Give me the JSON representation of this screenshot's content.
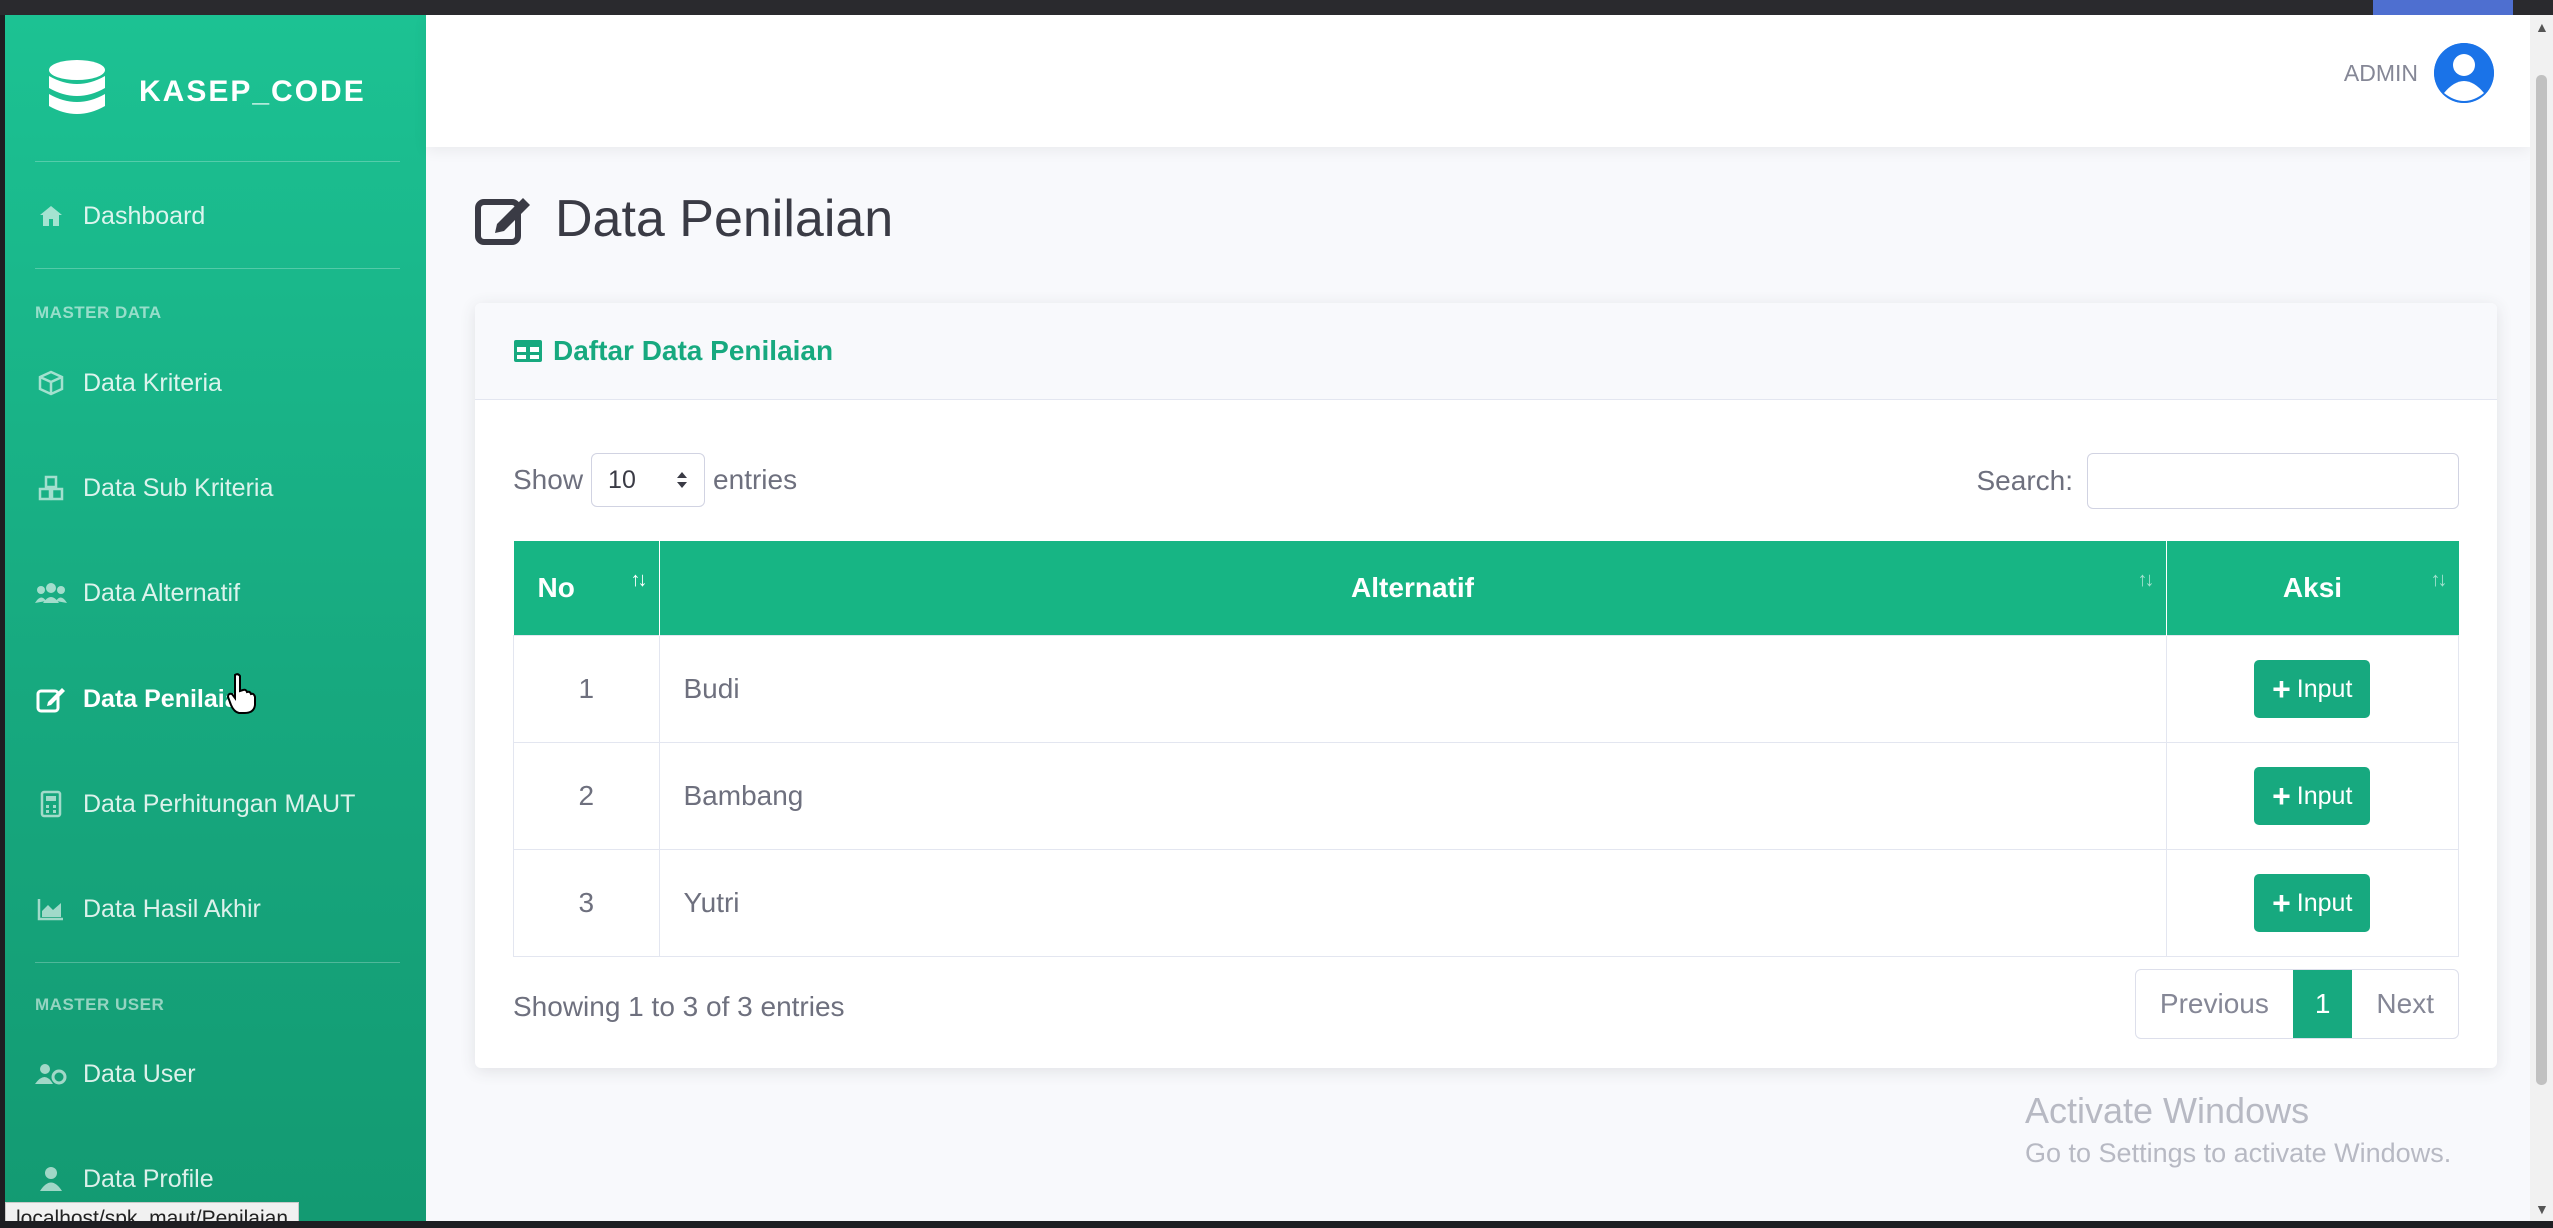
{
  "brand": {
    "name": "KASEP_CODE"
  },
  "sidebar": {
    "dashboard": "Dashboard",
    "section_master_data": "MASTER DATA",
    "items": [
      {
        "label": "Data Kriteria",
        "icon": "cube-icon"
      },
      {
        "label": "Data Sub Kriteria",
        "icon": "cubes-icon"
      },
      {
        "label": "Data Alternatif",
        "icon": "users-icon"
      },
      {
        "label": "Data Penilaian",
        "icon": "edit-icon",
        "active": true
      },
      {
        "label": "Data Perhitungan MAUT",
        "icon": "calculator-icon"
      },
      {
        "label": "Data Hasil Akhir",
        "icon": "chart-area-icon"
      }
    ],
    "section_master_user": "MASTER USER",
    "user_items": [
      {
        "label": "Data User",
        "icon": "users-cog-icon"
      },
      {
        "label": "Data Profile",
        "icon": "user-icon"
      }
    ]
  },
  "topbar": {
    "user": "ADMIN"
  },
  "page": {
    "title": "Data Penilaian"
  },
  "card": {
    "title": "Daftar Data Penilaian",
    "show_label": "Show",
    "entries_value": "10",
    "entries_label": "entries",
    "search_label": "Search:",
    "search_value": ""
  },
  "table": {
    "headers": [
      "No",
      "Alternatif",
      "Aksi"
    ],
    "rows": [
      {
        "no": "1",
        "alternatif": "Budi",
        "action": "Input"
      },
      {
        "no": "2",
        "alternatif": "Bambang",
        "action": "Input"
      },
      {
        "no": "3",
        "alternatif": "Yutri",
        "action": "Input"
      }
    ]
  },
  "footer": {
    "info": "Showing 1 to 3 of 3 entries",
    "previous": "Previous",
    "current_page": "1",
    "next": "Next"
  },
  "watermark": {
    "line1": "Activate Windows",
    "line2": "Go to Settings to activate Windows."
  },
  "status_url": "localhost/spk_maut/Penilaian",
  "colors": {
    "primary": "#17a97f",
    "header": "#17b584",
    "avatar": "#1a73e8"
  }
}
